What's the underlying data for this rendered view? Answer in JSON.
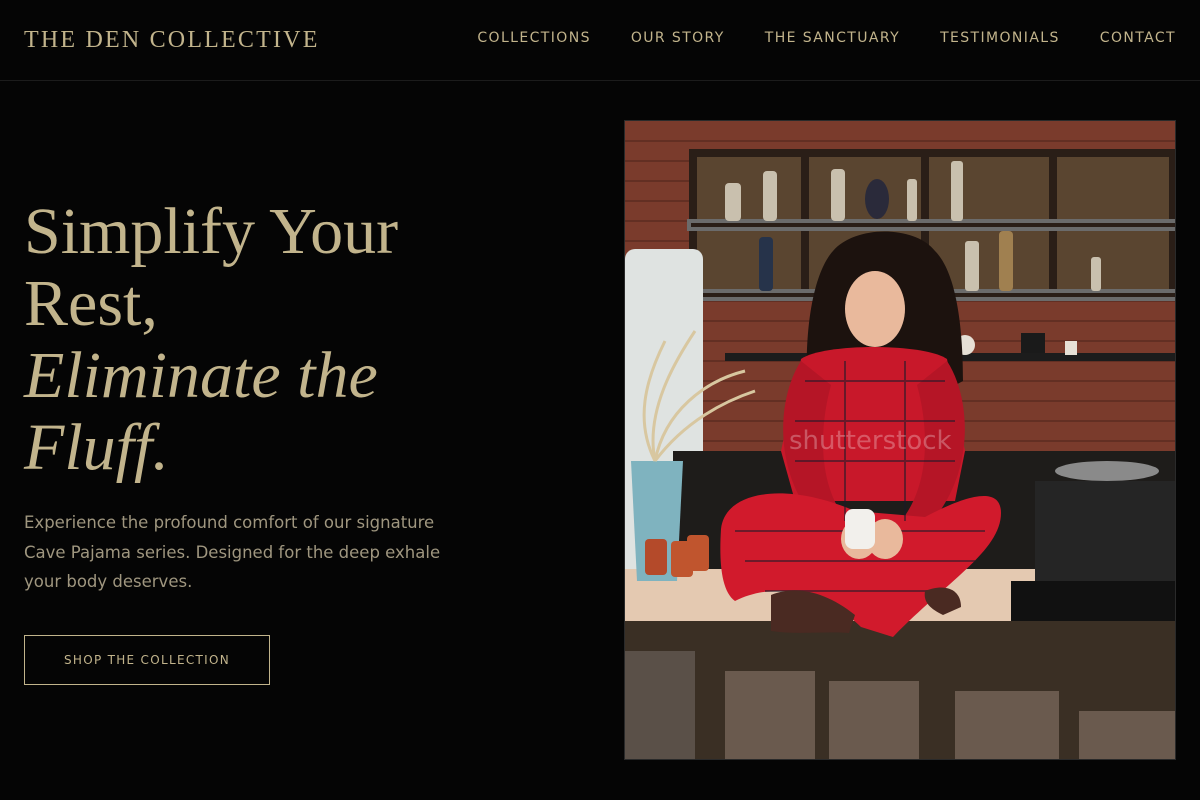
{
  "header": {
    "brand": "THE DEN COLLECTIVE",
    "nav": [
      "COLLECTIONS",
      "OUR STORY",
      "THE SANCTUARY",
      "TESTIMONIALS",
      "CONTACT"
    ]
  },
  "hero": {
    "title_line1": "Simplify Your",
    "title_line2": "Rest,",
    "title_line3": "Eliminate the",
    "title_line4": "Fluff.",
    "subtitle": "Experience the profound comfort of our signature Cave Pajama series. Designed for the deep exhale your body deserves.",
    "cta_label": "SHOP THE COLLECTION"
  },
  "image": {
    "watermark": "shutterstock"
  },
  "colors": {
    "background": "#050505",
    "accent_gold": "#c2b48c",
    "muted_text": "#9f967f"
  }
}
